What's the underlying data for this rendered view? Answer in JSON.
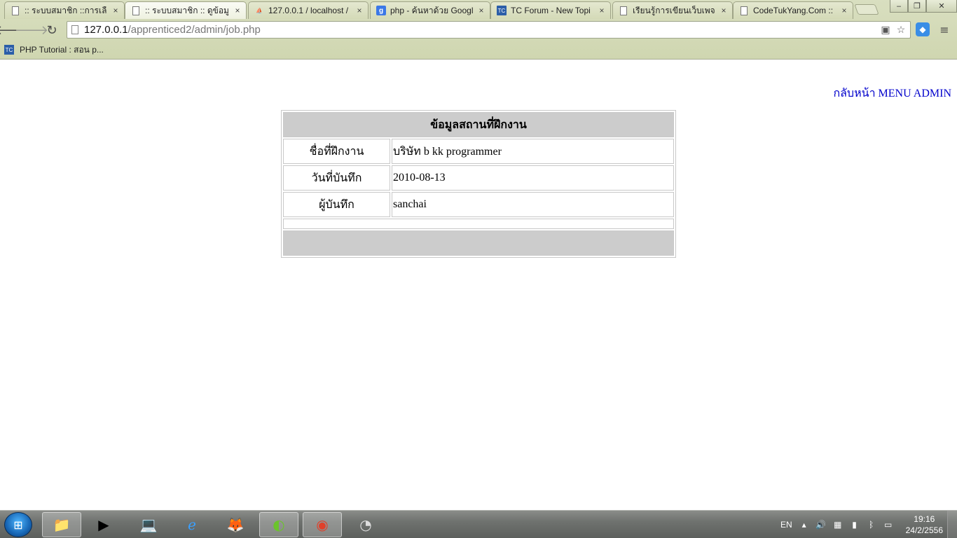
{
  "browser": {
    "tabs": [
      {
        "title": ":: ระบบสมาชิก ::การเลือก",
        "icon": "document-icon"
      },
      {
        "title": ":: ระบบสมาชิก :: ดูข้อมูลส",
        "icon": "document-icon",
        "active": true
      },
      {
        "title": "127.0.0.1 / localhost /",
        "icon": "phpmyadmin-icon"
      },
      {
        "title": "php - ค้นหาด้วย Googl",
        "icon": "google-icon"
      },
      {
        "title": "TC Forum - New Topi",
        "icon": "tc-forum-icon"
      },
      {
        "title": "เรียนรู้การเขียนเว็บเพจ",
        "icon": "document-icon"
      },
      {
        "title": "CodeTukYang.Com ::",
        "icon": "document-icon"
      }
    ],
    "tab_close_glyph": "×",
    "address": {
      "host": "127.0.0.1",
      "path": "/apprenticed2/admin/job.php"
    },
    "bookmarks": [
      {
        "label": "PHP Tutorial : สอน p...",
        "icon": "tc-forum-icon"
      }
    ]
  },
  "page": {
    "back_link": "กลับหน้า MENU ADMIN",
    "table": {
      "title": "ข้อมูลสถานที่ฝึกงาน",
      "rows": [
        {
          "label": "ชื่อที่ฝึกงาน",
          "value": "บริษัท b kk programmer"
        },
        {
          "label": "วันที่บันทึก",
          "value": "2010-08-13"
        },
        {
          "label": "ผู้บันทึก",
          "value": "sanchai"
        }
      ]
    }
  },
  "taskbar": {
    "language": "EN",
    "time": "19:16",
    "date": "24/2/2556",
    "pinned": [
      "explorer-icon",
      "media-player-icon",
      "system-icon",
      "internet-explorer-icon",
      "firefox-icon",
      "dreamweaver-icon",
      "chrome-icon",
      "recovery-icon"
    ]
  },
  "colors": {
    "link": "#0000cc",
    "table_header_bg": "#cccccc",
    "table_border": "#c8c8c8",
    "chrome_frame": "#d9dfc0"
  }
}
